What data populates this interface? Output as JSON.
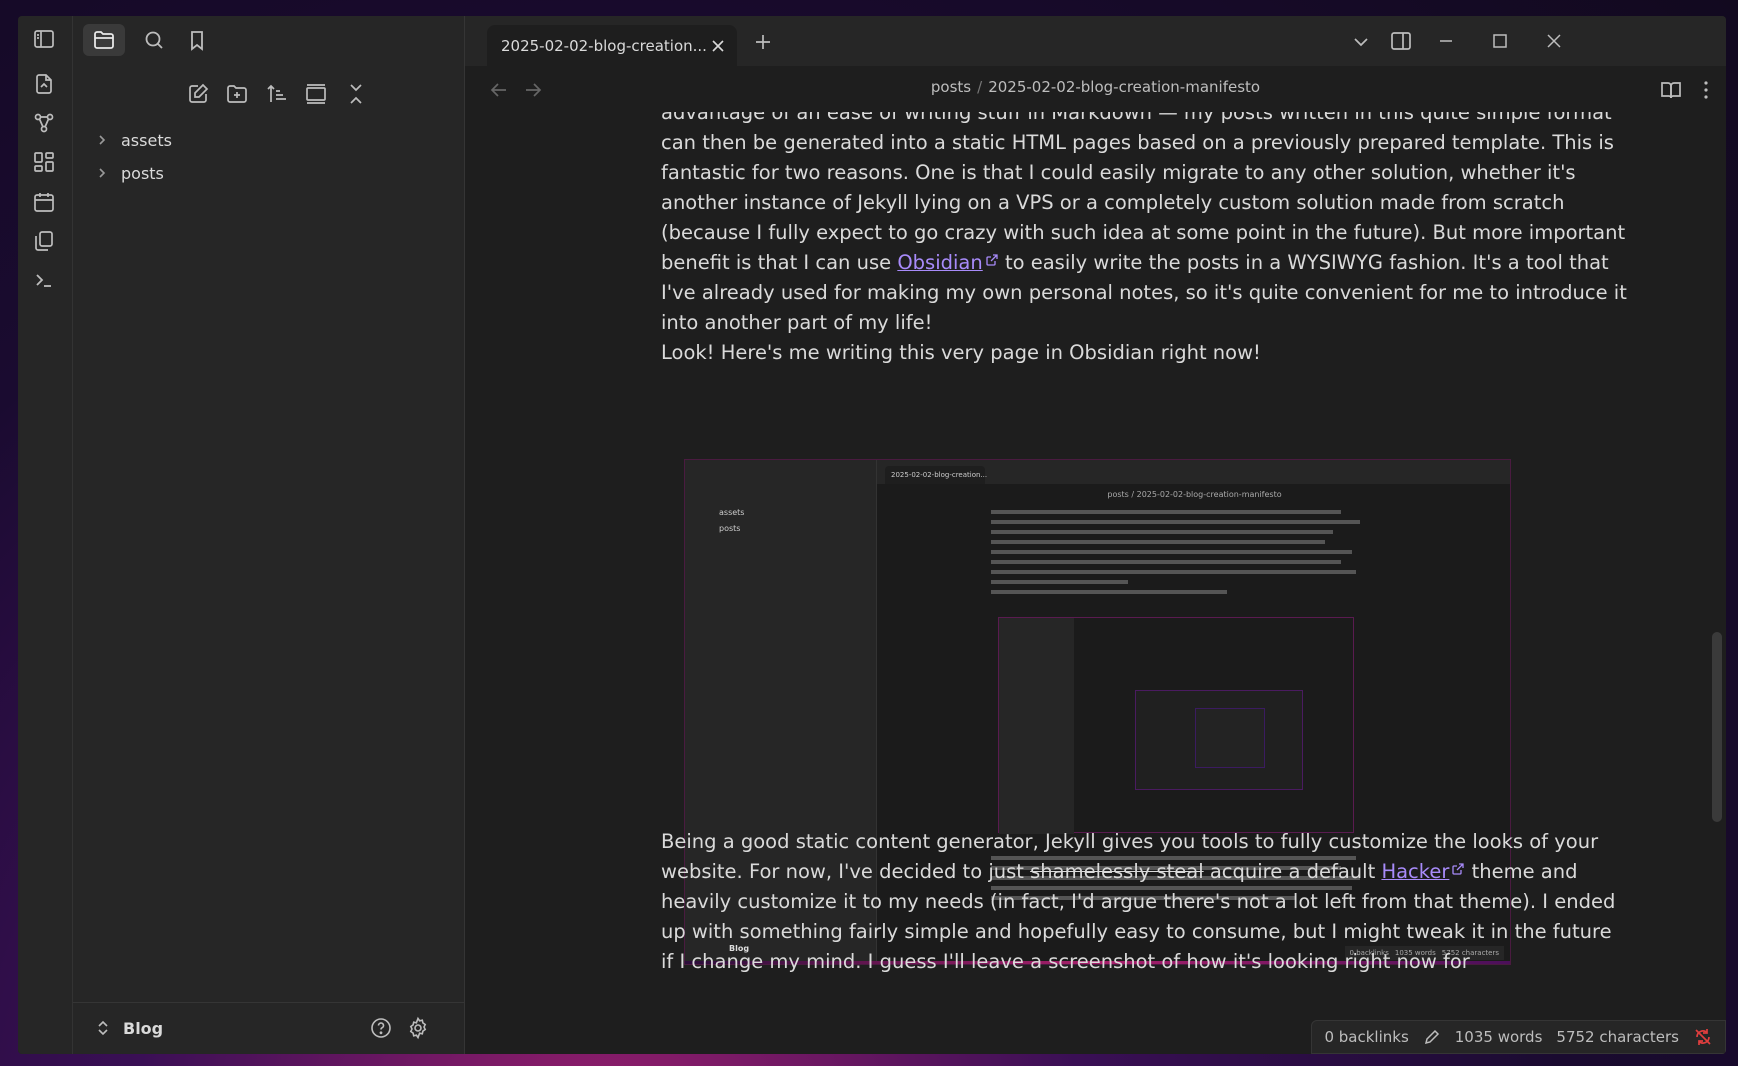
{
  "ribbon": {
    "icons": [
      "sidebar-toggle-icon",
      "open-quick-switcher-icon",
      "graph-view-icon",
      "canvas-icon",
      "daily-note-icon",
      "templates-icon",
      "command-palette-icon"
    ]
  },
  "sidebar": {
    "tabs": [
      "files-icon",
      "search-icon",
      "bookmarks-icon"
    ],
    "actions": [
      "new-note-icon",
      "new-folder-icon",
      "sort-icon",
      "collapse-view-icon",
      "collapse-all-icon"
    ],
    "tree": [
      {
        "label": "assets"
      },
      {
        "label": "posts"
      }
    ],
    "vault_name": "Blog"
  },
  "tab": {
    "title": "2025-02-02-blog-creation..."
  },
  "breadcrumb": {
    "folder": "posts",
    "separator": "/",
    "file": "2025-02-02-blog-creation-manifesto"
  },
  "content": {
    "lines_top": [
      "advantage of an ease of writing stuff in Markdown — my posts written in this quite simple format",
      "can then be generated into a static HTML pages based on a previously prepared template. This is",
      "fantastic for two reasons. One is that I could easily migrate to any other solution, whether it's",
      "another instance of Jekyll lying on a VPS or a completely custom solution made from scratch",
      "(because I fully expect to go crazy with such idea at some point in the future). But more important"
    ],
    "line_obsidian_pre": "benefit is that I can use ",
    "obsidian_link": "Obsidian",
    "line_obsidian_post": " to easily write the posts in a WYSIWYG fashion. It's a tool that",
    "lines_after": [
      "I've already used for making my own personal notes, so it's quite convenient for me to introduce it",
      "into another part of my life!",
      "Look! Here's me writing this very page in Obsidian right now!"
    ],
    "para2_line1": "Being a good static content generator, Jekyll gives you tools to fully customize the looks of your",
    "para2_line2_pre": "website. For now, I've decided to just ",
    "para2_strike": "shamelessly steal",
    "para2_line2_mid": " acquire a default ",
    "hacker_link": "Hacker",
    "para2_line2_post": " theme and",
    "para2_rest": [
      "heavily customize it to my needs (in fact, I'd argue there's not a lot left from that theme). I ended",
      "up with something fairly simple and hopefully easy to consume, but I might tweak it in the future",
      "if I change my mind. I guess I'll leave a screenshot of how it's looking right now for"
    ]
  },
  "embed": {
    "tab_title": "2025-02-02-blog-creation...",
    "breadcrumb": "posts / 2025-02-02-blog-creation-manifesto",
    "tree": [
      "assets",
      "posts"
    ],
    "vault_name": "Blog",
    "status": {
      "backlinks": "0 backlinks",
      "words": "1035 words",
      "chars": "5752 characters"
    }
  },
  "status": {
    "backlinks": "0 backlinks",
    "words": "1035 words",
    "characters": "5752 characters"
  },
  "colors": {
    "accent": "#a88bfa",
    "sync_error": "#e03e3e"
  }
}
